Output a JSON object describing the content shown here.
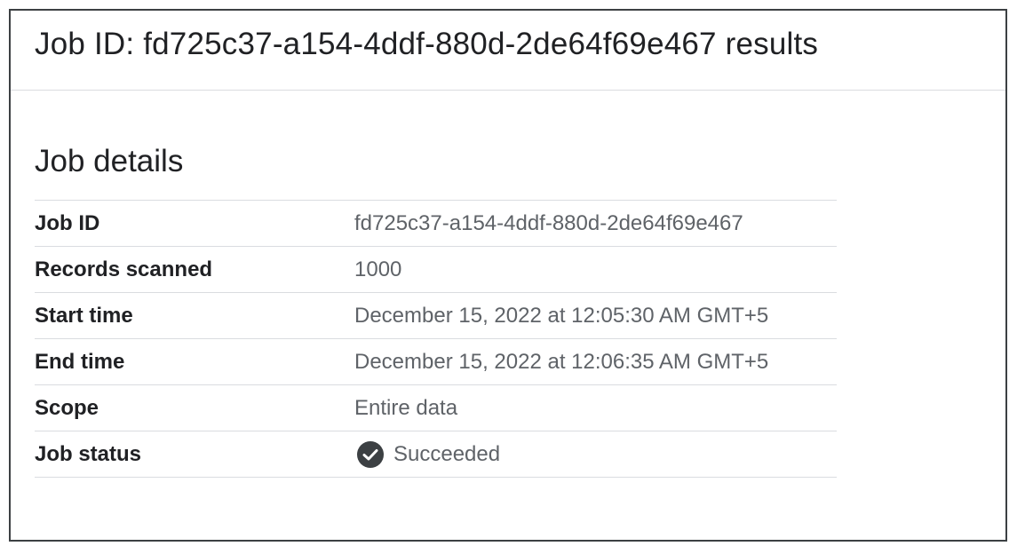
{
  "header": {
    "title": "Job ID: fd725c37-a154-4ddf-880d-2de64f69e467 results"
  },
  "job_details": {
    "section_title": "Job details",
    "rows": [
      {
        "label": "Job ID",
        "value": "fd725c37-a154-4ddf-880d-2de64f69e467"
      },
      {
        "label": "Records scanned",
        "value": "1000"
      },
      {
        "label": "Start time",
        "value": "December 15, 2022 at 12:05:30 AM GMT+5"
      },
      {
        "label": "End time",
        "value": "December 15, 2022 at 12:06:35 AM GMT+5"
      },
      {
        "label": "Scope",
        "value": "Entire data"
      },
      {
        "label": "Job status",
        "value": "Succeeded",
        "icon": "check-circle-icon"
      }
    ]
  },
  "colors": {
    "text_primary": "#202124",
    "text_secondary": "#5f6368",
    "divider": "#dadce0",
    "border": "#3c4043",
    "status_icon": "#3c4043"
  }
}
